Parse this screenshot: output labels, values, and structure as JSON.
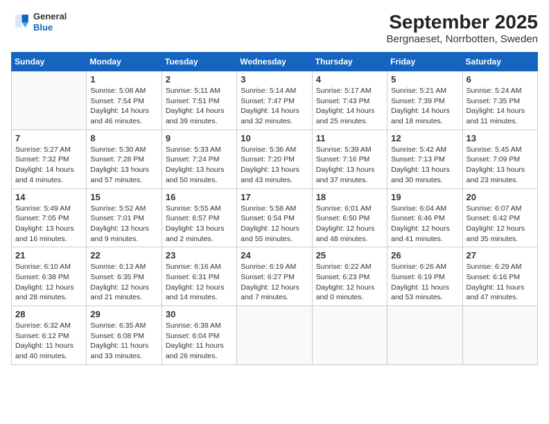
{
  "header": {
    "logo": {
      "general": "General",
      "blue": "Blue"
    },
    "title": "September 2025",
    "subtitle": "Bergnaeset, Norrbotten, Sweden"
  },
  "calendar": {
    "days_of_week": [
      "Sunday",
      "Monday",
      "Tuesday",
      "Wednesday",
      "Thursday",
      "Friday",
      "Saturday"
    ],
    "weeks": [
      [
        {
          "day": "",
          "detail": ""
        },
        {
          "day": "1",
          "detail": "Sunrise: 5:08 AM\nSunset: 7:54 PM\nDaylight: 14 hours\nand 46 minutes."
        },
        {
          "day": "2",
          "detail": "Sunrise: 5:11 AM\nSunset: 7:51 PM\nDaylight: 14 hours\nand 39 minutes."
        },
        {
          "day": "3",
          "detail": "Sunrise: 5:14 AM\nSunset: 7:47 PM\nDaylight: 14 hours\nand 32 minutes."
        },
        {
          "day": "4",
          "detail": "Sunrise: 5:17 AM\nSunset: 7:43 PM\nDaylight: 14 hours\nand 25 minutes."
        },
        {
          "day": "5",
          "detail": "Sunrise: 5:21 AM\nSunset: 7:39 PM\nDaylight: 14 hours\nand 18 minutes."
        },
        {
          "day": "6",
          "detail": "Sunrise: 5:24 AM\nSunset: 7:35 PM\nDaylight: 14 hours\nand 11 minutes."
        }
      ],
      [
        {
          "day": "7",
          "detail": "Sunrise: 5:27 AM\nSunset: 7:32 PM\nDaylight: 14 hours\nand 4 minutes."
        },
        {
          "day": "8",
          "detail": "Sunrise: 5:30 AM\nSunset: 7:28 PM\nDaylight: 13 hours\nand 57 minutes."
        },
        {
          "day": "9",
          "detail": "Sunrise: 5:33 AM\nSunset: 7:24 PM\nDaylight: 13 hours\nand 50 minutes."
        },
        {
          "day": "10",
          "detail": "Sunrise: 5:36 AM\nSunset: 7:20 PM\nDaylight: 13 hours\nand 43 minutes."
        },
        {
          "day": "11",
          "detail": "Sunrise: 5:39 AM\nSunset: 7:16 PM\nDaylight: 13 hours\nand 37 minutes."
        },
        {
          "day": "12",
          "detail": "Sunrise: 5:42 AM\nSunset: 7:13 PM\nDaylight: 13 hours\nand 30 minutes."
        },
        {
          "day": "13",
          "detail": "Sunrise: 5:45 AM\nSunset: 7:09 PM\nDaylight: 13 hours\nand 23 minutes."
        }
      ],
      [
        {
          "day": "14",
          "detail": "Sunrise: 5:49 AM\nSunset: 7:05 PM\nDaylight: 13 hours\nand 16 minutes."
        },
        {
          "day": "15",
          "detail": "Sunrise: 5:52 AM\nSunset: 7:01 PM\nDaylight: 13 hours\nand 9 minutes."
        },
        {
          "day": "16",
          "detail": "Sunrise: 5:55 AM\nSunset: 6:57 PM\nDaylight: 13 hours\nand 2 minutes."
        },
        {
          "day": "17",
          "detail": "Sunrise: 5:58 AM\nSunset: 6:54 PM\nDaylight: 12 hours\nand 55 minutes."
        },
        {
          "day": "18",
          "detail": "Sunrise: 6:01 AM\nSunset: 6:50 PM\nDaylight: 12 hours\nand 48 minutes."
        },
        {
          "day": "19",
          "detail": "Sunrise: 6:04 AM\nSunset: 6:46 PM\nDaylight: 12 hours\nand 41 minutes."
        },
        {
          "day": "20",
          "detail": "Sunrise: 6:07 AM\nSunset: 6:42 PM\nDaylight: 12 hours\nand 35 minutes."
        }
      ],
      [
        {
          "day": "21",
          "detail": "Sunrise: 6:10 AM\nSunset: 6:38 PM\nDaylight: 12 hours\nand 28 minutes."
        },
        {
          "day": "22",
          "detail": "Sunrise: 6:13 AM\nSunset: 6:35 PM\nDaylight: 12 hours\nand 21 minutes."
        },
        {
          "day": "23",
          "detail": "Sunrise: 6:16 AM\nSunset: 6:31 PM\nDaylight: 12 hours\nand 14 minutes."
        },
        {
          "day": "24",
          "detail": "Sunrise: 6:19 AM\nSunset: 6:27 PM\nDaylight: 12 hours\nand 7 minutes."
        },
        {
          "day": "25",
          "detail": "Sunrise: 6:22 AM\nSunset: 6:23 PM\nDaylight: 12 hours\nand 0 minutes."
        },
        {
          "day": "26",
          "detail": "Sunrise: 6:26 AM\nSunset: 6:19 PM\nDaylight: 11 hours\nand 53 minutes."
        },
        {
          "day": "27",
          "detail": "Sunrise: 6:29 AM\nSunset: 6:16 PM\nDaylight: 11 hours\nand 47 minutes."
        }
      ],
      [
        {
          "day": "28",
          "detail": "Sunrise: 6:32 AM\nSunset: 6:12 PM\nDaylight: 11 hours\nand 40 minutes."
        },
        {
          "day": "29",
          "detail": "Sunrise: 6:35 AM\nSunset: 6:08 PM\nDaylight: 11 hours\nand 33 minutes."
        },
        {
          "day": "30",
          "detail": "Sunrise: 6:38 AM\nSunset: 6:04 PM\nDaylight: 11 hours\nand 26 minutes."
        },
        {
          "day": "",
          "detail": ""
        },
        {
          "day": "",
          "detail": ""
        },
        {
          "day": "",
          "detail": ""
        },
        {
          "day": "",
          "detail": ""
        }
      ]
    ]
  }
}
